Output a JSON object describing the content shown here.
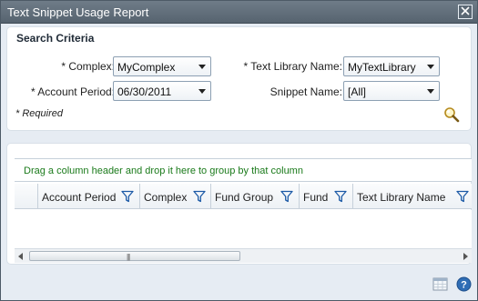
{
  "window": {
    "title": "Text Snippet Usage Report"
  },
  "criteria": {
    "heading": "Search Criteria",
    "complex_label": "* Complex:",
    "complex_value": "MyComplex",
    "account_period_label": "* Account Period:",
    "account_period_value": "06/30/2011",
    "text_library_label": "* Text Library Name:",
    "text_library_value": "MyTextLibrary",
    "snippet_name_label": "Snippet Name:",
    "snippet_name_value": "[All]",
    "required_note": "* Required"
  },
  "grid": {
    "group_hint": "Drag a column header and drop it here to group by that column",
    "columns": [
      "Account Period",
      "Complex",
      "Fund Group",
      "Fund",
      "Text Library Name"
    ]
  },
  "icons": {
    "close": "close-icon",
    "search": "magnifier-icon",
    "filter": "funnel-icon",
    "export": "table-export-icon",
    "help": "help-icon"
  },
  "colors": {
    "titlebar": "#5e6b77",
    "panel_bg": "#e6ecf3",
    "hint_text": "#1a7a1a",
    "filter_icon": "#1c5aa6"
  }
}
